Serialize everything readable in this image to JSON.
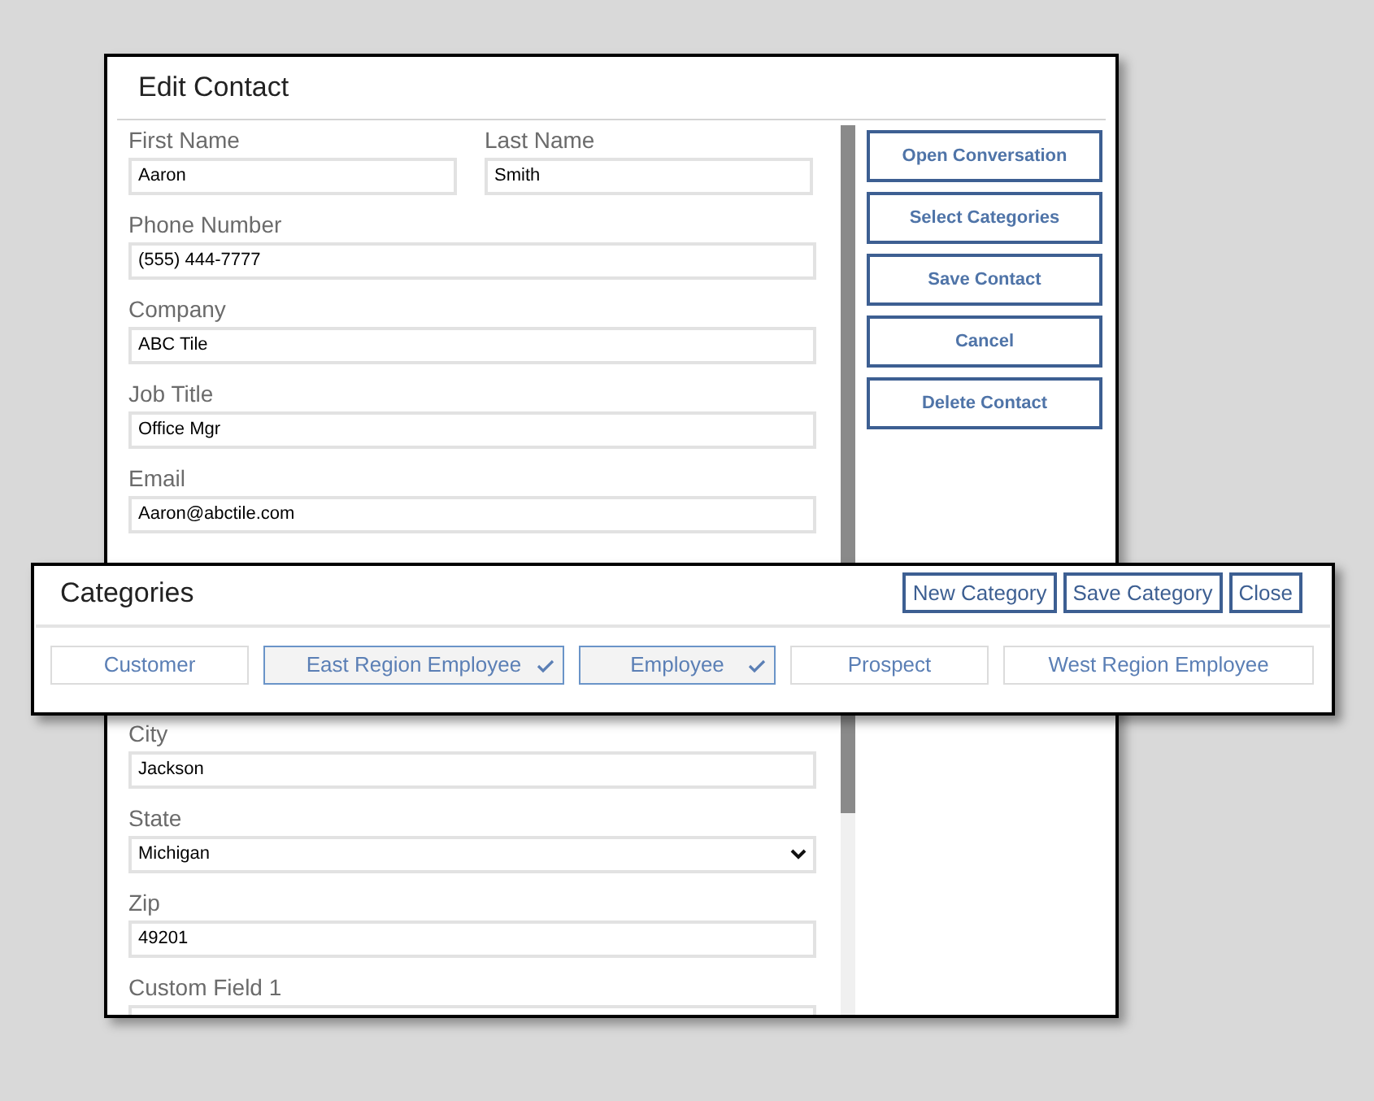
{
  "window": {
    "title": "Edit Contact"
  },
  "fields": [
    {
      "kind": "pair",
      "items": [
        {
          "label": "First Name",
          "value": "Aaron"
        },
        {
          "label": "Last Name",
          "value": "Smith"
        }
      ]
    },
    {
      "kind": "text",
      "label": "Phone Number",
      "value": "(555) 444-7777"
    },
    {
      "kind": "text",
      "label": "Company",
      "value": "ABC Tile"
    },
    {
      "kind": "text",
      "label": "Job Title",
      "value": "Office Mgr"
    },
    {
      "kind": "text",
      "label": "Email",
      "value": "Aaron@abctile.com"
    },
    {
      "kind": "text",
      "label": "City",
      "value": "Jackson"
    },
    {
      "kind": "select",
      "label": "State",
      "value": "Michigan"
    },
    {
      "kind": "text",
      "label": "Zip",
      "value": "49201"
    },
    {
      "kind": "text",
      "label": "Custom Field 1"
    }
  ],
  "actions": [
    "Open Conversation",
    "Select Categories",
    "Save Contact",
    "Cancel",
    "Delete Contact"
  ],
  "categories_dialog": {
    "title": "Categories",
    "buttons": [
      "New Category",
      "Save Category",
      "Close"
    ],
    "categories": [
      {
        "label": "Customer",
        "selected": false
      },
      {
        "label": "East Region Employee",
        "selected": true
      },
      {
        "label": "Employee",
        "selected": true
      },
      {
        "label": "Prospect",
        "selected": false
      },
      {
        "label": "West Region Employee",
        "selected": false
      }
    ]
  }
}
